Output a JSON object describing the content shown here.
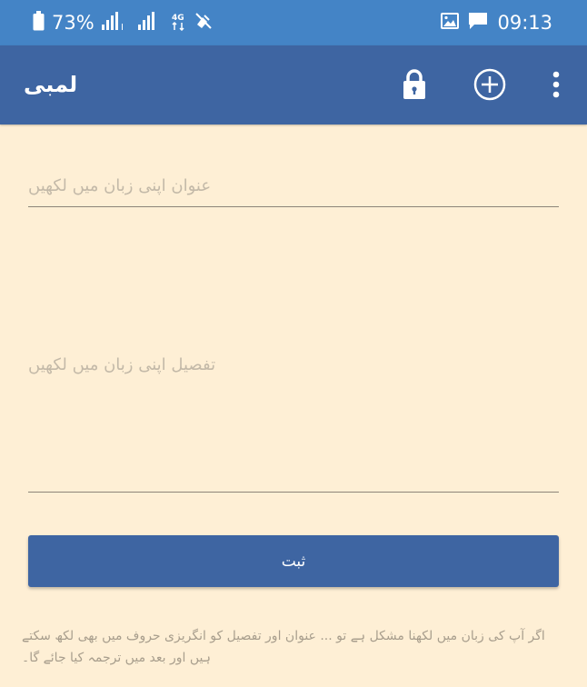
{
  "status_bar": {
    "time": "09:13",
    "battery_percent": "73%"
  },
  "app_bar": {
    "title": "لمبی",
    "icons": [
      "lock-icon",
      "add-circle-icon",
      "more-vert-icon"
    ]
  },
  "form": {
    "title_field": {
      "placeholder": "عنوان اپنی زبان میں لکھیں",
      "value": ""
    },
    "body_field": {
      "placeholder": "تفصیل اپنی زبان میں لکھیں",
      "value": ""
    },
    "submit_label": "ثبت"
  },
  "footnote": "اگر آپ کی زبان میں لکھنا مشکل ہے تو ... عنوان اور تفصیل کو انگریزی حروف میں بھی لکھ سکتے ہیں اور بعد میں ترجمہ کیا جائے گا۔",
  "colors": {
    "status_bar": "#4484C6",
    "app_bar": "#3E65A2",
    "background": "#FEEFD5",
    "placeholder": "#C3B9A8",
    "underline": "#8C8578",
    "button": "#3E65A2"
  }
}
